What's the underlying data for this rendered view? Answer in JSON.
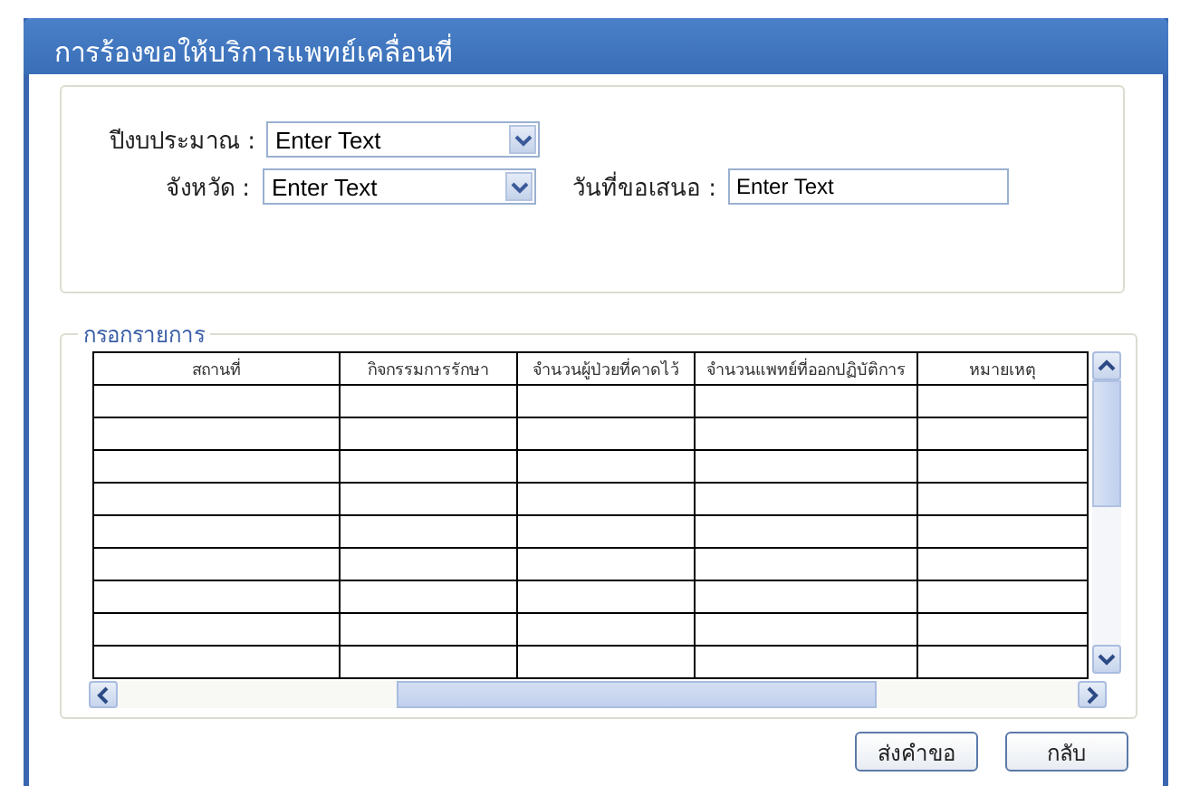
{
  "window": {
    "title": "การร้องขอให้บริการแพทย์เคลื่อนที่"
  },
  "filters": [
    {
      "kind": "select",
      "label": "ปีงบประมาณ :",
      "value": "Enter Text"
    },
    {
      "kind": "select",
      "label": "จังหวัด :",
      "value": "Enter Text"
    },
    {
      "kind": "text",
      "label": "วันที่ขอเสนอ :",
      "value": "Enter Text"
    }
  ],
  "entry_section": {
    "title": "กรอกรายการ",
    "table": {
      "columns": [
        "สถานที่",
        "กิจกรรมการรักษา",
        "จำนวนผู้ป่วยที่คาดไว้",
        "จำนวนแพทย์ที่ออกปฏิบัติการ",
        "หมายเหตุ"
      ],
      "rows": [
        {
          "kind": "empty"
        },
        {
          "kind": "empty"
        },
        {
          "kind": "empty"
        },
        {
          "kind": "empty"
        },
        {
          "kind": "empty"
        },
        {
          "kind": "empty"
        },
        {
          "kind": "empty"
        },
        {
          "kind": "empty"
        },
        {
          "kind": "empty"
        }
      ]
    }
  },
  "buttons": [
    "ส่งคำขอ",
    "กลับ"
  ]
}
